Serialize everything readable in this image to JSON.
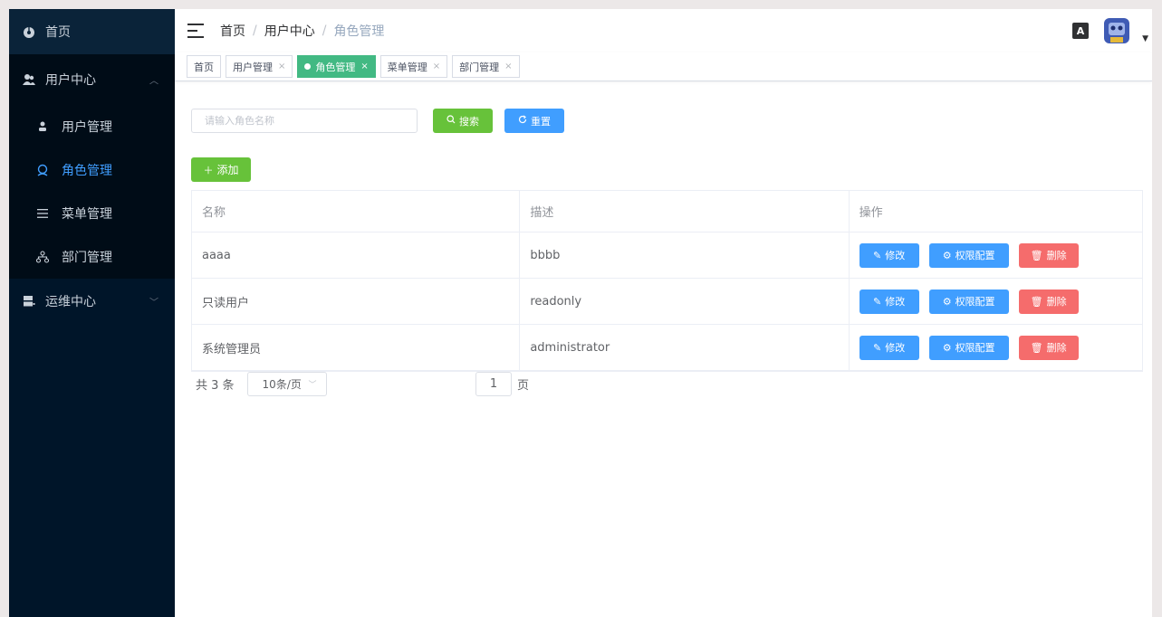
{
  "sidebar": {
    "home": {
      "label": "首页",
      "icon": "dashboard-icon"
    },
    "user_center": {
      "label": "用户中心",
      "icon": "users-icon"
    },
    "sub_items": [
      {
        "label": "用户管理",
        "icon": "user-icon"
      },
      {
        "label": "角色管理",
        "icon": "role-icon"
      },
      {
        "label": "菜单管理",
        "icon": "menu-list-icon"
      },
      {
        "label": "部门管理",
        "icon": "tree-icon"
      }
    ],
    "ops_center": {
      "label": "运维中心",
      "icon": "server-icon"
    }
  },
  "header": {
    "breadcrumb": [
      "首页",
      "用户中心",
      "角色管理"
    ],
    "separator": "/",
    "lang_label": "A"
  },
  "tags": [
    {
      "label": "首页",
      "closable": false
    },
    {
      "label": "用户管理",
      "closable": true
    },
    {
      "label": "角色管理",
      "closable": true,
      "active": true
    },
    {
      "label": "菜单管理",
      "closable": true
    },
    {
      "label": "部门管理",
      "closable": true
    }
  ],
  "tag_close": "×",
  "search": {
    "placeholder": "请输入角色名称",
    "search_label": "搜索",
    "reset_label": "重置"
  },
  "add_label": "添加",
  "table": {
    "headers": [
      "名称",
      "描述",
      "操作"
    ],
    "rows": [
      {
        "name": "aaaa",
        "desc": "bbbb"
      },
      {
        "name": "只读用户",
        "desc": "readonly"
      },
      {
        "name": "系统管理员",
        "desc": "administrator"
      }
    ],
    "actions": {
      "edit": "修改",
      "perm": "权限配置",
      "del": "删除"
    }
  },
  "pager": {
    "total": "共 3 条",
    "page_size": "10条/页",
    "current": "1",
    "page_unit": "页"
  },
  "colors": {
    "sidebar_bg": "#001529",
    "active_tag": "#42b983",
    "primary": "#409eff",
    "success": "#67c23a",
    "danger": "#f56c6c"
  }
}
